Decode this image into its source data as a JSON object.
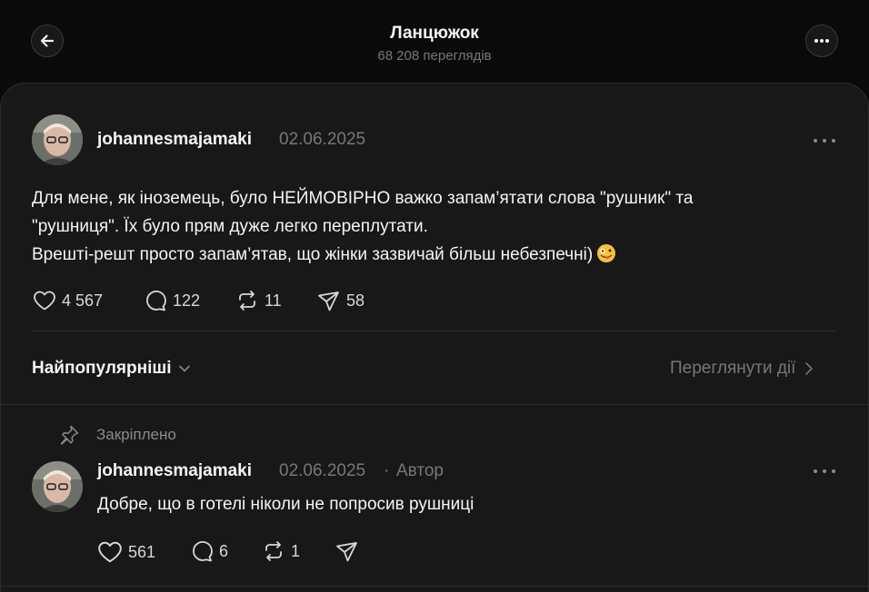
{
  "header": {
    "title": "Ланцюжок",
    "views": "68 208 переглядів",
    "back_icon": "arrow-left-icon",
    "more_icon": "more-icon"
  },
  "post": {
    "username": "johannesmajamaki",
    "date": "02.06.2025",
    "text_lines": [
      "Для мене, як іноземець, було НЕЙМОВІРНО важко запам’ятати слова \"рушник\" та",
      "\"рушниця\". Їх було прям дуже легко переплутати.",
      "Врешті-решт просто запам’ятав, що жінки зазвичай більш небезпечні)"
    ],
    "emoji_icon": "zany-face-emoji",
    "likes": "4 567",
    "comments": "122",
    "reposts": "11",
    "shares": "58"
  },
  "thread_controls": {
    "sort_label": "Найпопулярніші",
    "activity_label": "Переглянути дії"
  },
  "reply": {
    "pinned_label": "Закріплено",
    "username": "johannesmajamaki",
    "date": "02.06.2025",
    "separator": "·",
    "author_badge": "Автор",
    "text": "Добре, що в готелі ніколи не попросив рушниці",
    "likes": "561",
    "comments": "6",
    "reposts": "1"
  },
  "colors": {
    "background": "#0a0a0a",
    "panel": "#181818",
    "primary_text": "#f3f5f7",
    "secondary_text": "#777777"
  }
}
